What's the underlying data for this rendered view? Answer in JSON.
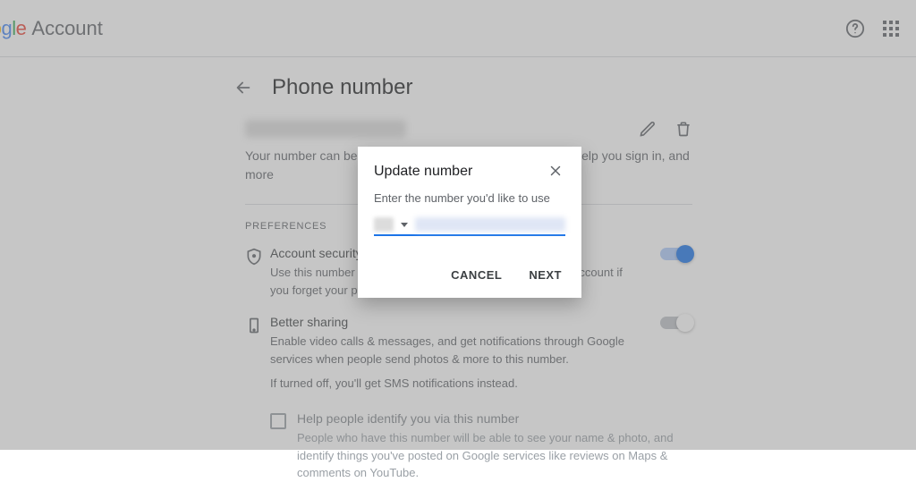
{
  "header": {
    "brand_suffix": "Account",
    "page_title": "Phone number"
  },
  "main": {
    "phone_display": "(redacted)",
    "description": "Your number can be used to deliver important notifications, help you sign in, and more",
    "prefs_label": "PREFERENCES",
    "items": [
      {
        "title": "Account security",
        "desc": "Use this number to help you sign in and get back into your account if you forget your password if you forget it.",
        "toggle": true
      },
      {
        "title": "Better sharing",
        "desc": "Enable video calls & messages, and get notifications through Google services when people send photos & more to this number.",
        "footnote": "If turned off, you'll get SMS notifications instead.",
        "toggle": false
      }
    ],
    "identify": {
      "title": "Help people identify you via this number",
      "desc": "People who have this number will be able to see your name & photo, and identify things you've posted on Google services like reviews on Maps & comments on YouTube."
    }
  },
  "dialog": {
    "title": "Update number",
    "subtitle": "Enter the number you'd like to use",
    "phone_value": "(redacted)",
    "cancel": "CANCEL",
    "next": "NEXT"
  }
}
